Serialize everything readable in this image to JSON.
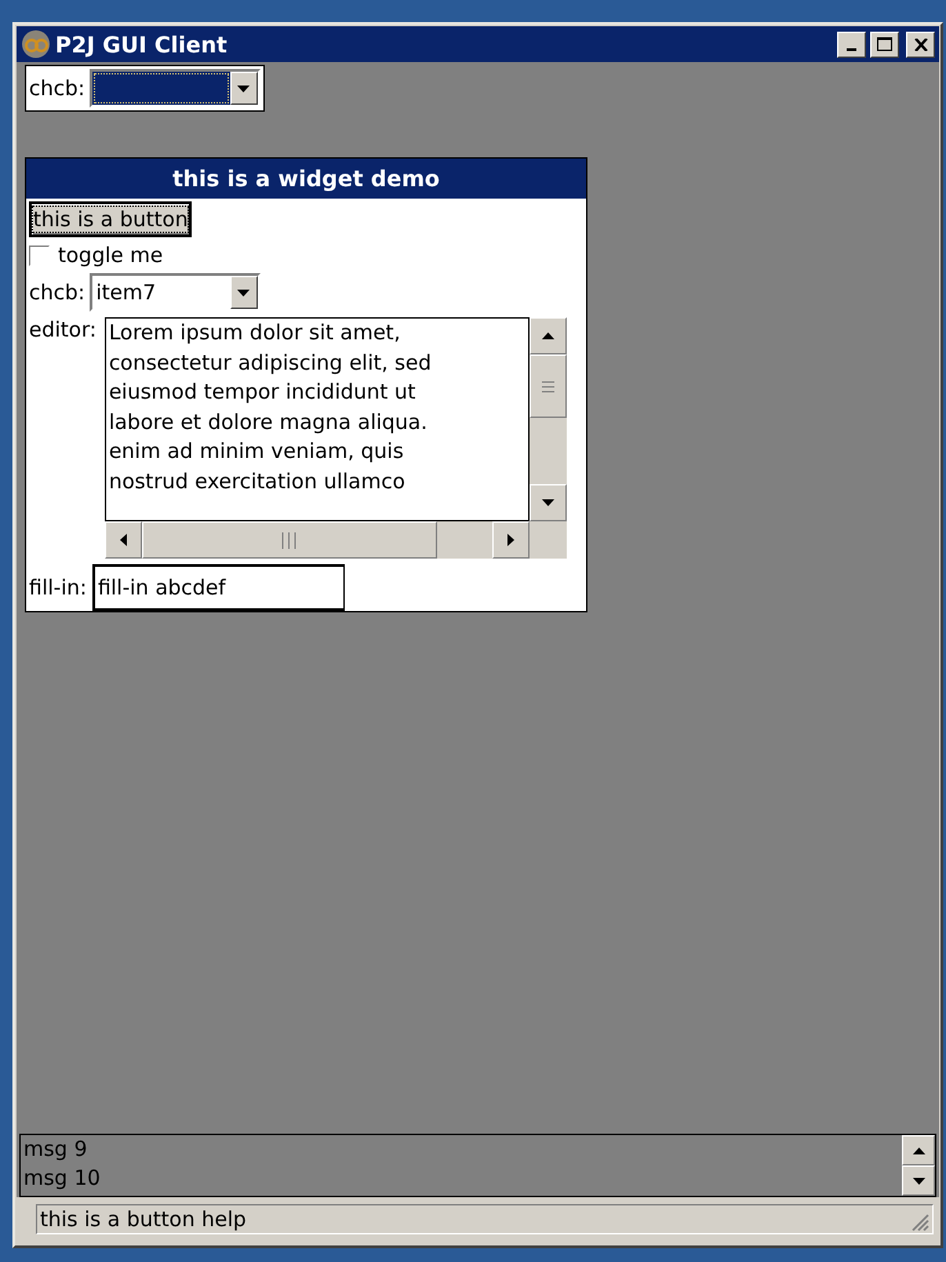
{
  "window": {
    "title": "P2J GUI Client"
  },
  "top_combo": {
    "label": "chcb:",
    "focused": true
  },
  "widget_frame": {
    "title": "this is a widget demo",
    "button": {
      "label": "this is a button",
      "focused": true
    },
    "toggle": {
      "label": "toggle me",
      "checked": false
    },
    "combo": {
      "label": "chcb:",
      "value": "item7"
    },
    "editor": {
      "label": "editor:",
      "text": "Lorem ipsum dolor sit amet,\nconsectetur adipiscing elit, sed\neiusmod tempor incididunt ut\nlabore et dolore magna aliqua.\nenim ad minim veniam, quis\nnostrud exercitation ullamco"
    },
    "fill_in": {
      "label": "fill-in:",
      "value": "fill-in abcdef"
    }
  },
  "messages": [
    "msg 9",
    "msg 10"
  ],
  "status_bar": {
    "text": "this is a button help"
  }
}
